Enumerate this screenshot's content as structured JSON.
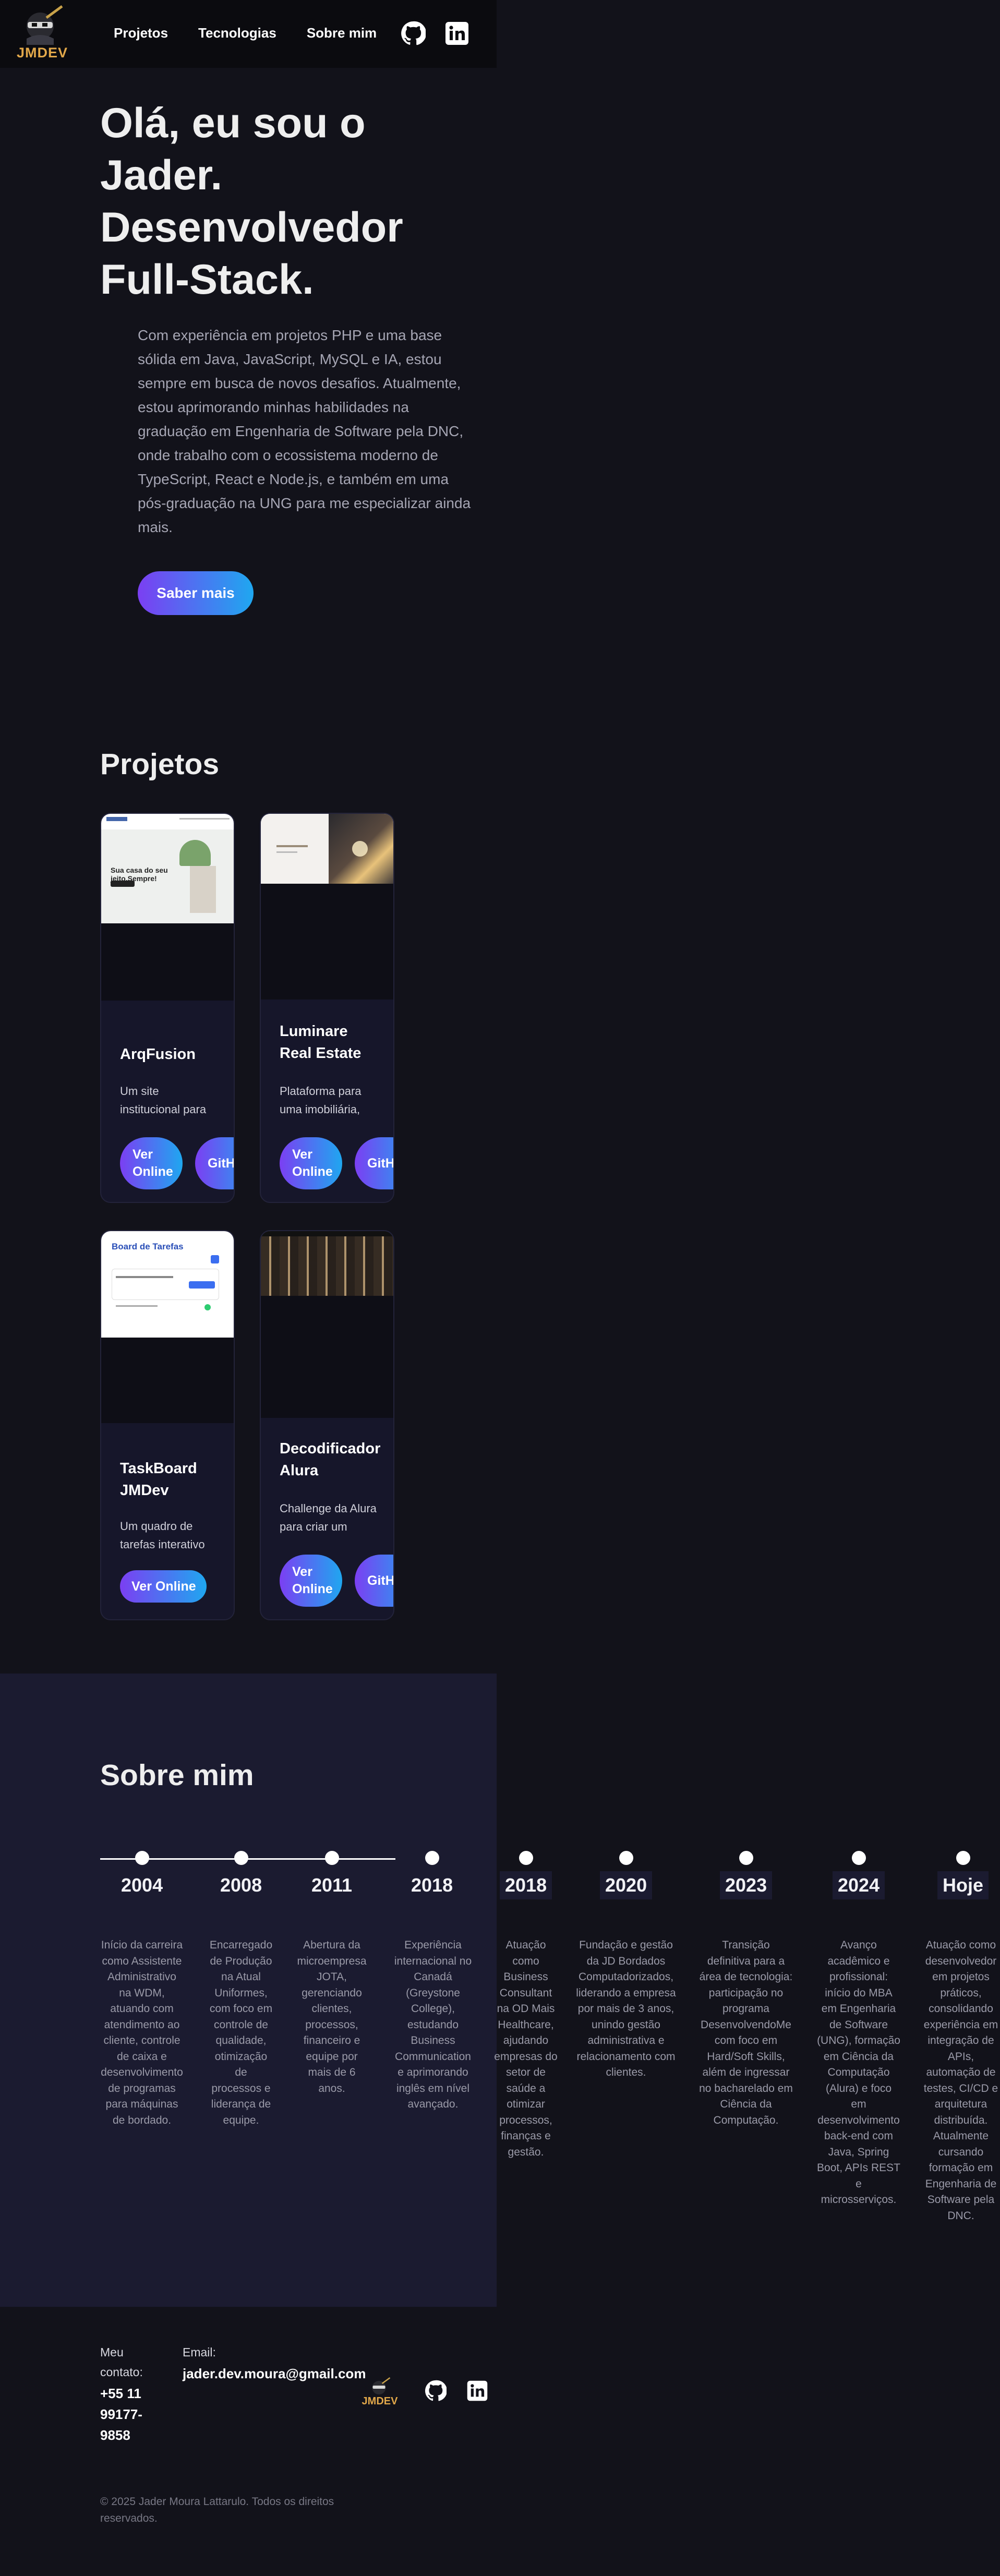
{
  "header": {
    "logo_text": "JMDEV",
    "nav": [
      "Projetos",
      "Tecnologias",
      "Sobre mim"
    ],
    "social": [
      "github-icon",
      "linkedin-icon"
    ]
  },
  "hero": {
    "title": "Olá, eu sou o Jader. Desenvolvedor Full-Stack.",
    "text": "Com experiência em projetos PHP e uma base sólida em Java, JavaScript, MySQL e IA, estou sempre em busca de novos desafios. Atualmente, estou aprimorando minhas habilidades na graduação em Engenharia de Software pela DNC, onde trabalho com o ecossistema moderno de TypeScript, React e Node.js, e também em uma pós-graduação na UNG para me especializar ainda mais.",
    "button": "Saber mais"
  },
  "projects": {
    "title": "Projetos",
    "items": [
      {
        "title": "ArqFusion",
        "desc": "Um site institucional para um escritório de",
        "buttons": [
          "Ver Online",
          "GitHub"
        ]
      },
      {
        "title": "Luminare Real Estate",
        "desc": "Plataforma para uma imobiliária, com listagem e",
        "buttons": [
          "Ver Online",
          "GitHub"
        ]
      },
      {
        "title": "TaskBoard JMDev",
        "desc": "Um quadro de tarefas interativo para organização",
        "buttons": [
          "Ver Online"
        ]
      },
      {
        "title": "Decodificador Alura",
        "desc": "Challenge da Alura para criar um decodificador de",
        "buttons": [
          "Ver Online",
          "GitHub"
        ]
      }
    ],
    "thumbs": {
      "arq_headline": "Sua casa do seu jeito.Sempre!",
      "task_title": "Board de Tarefas"
    }
  },
  "about": {
    "title": "Sobre mim",
    "timeline": [
      {
        "year": "2004",
        "desc": "Início da carreira como Assistente Administrativo na WDM, atuando com atendimento ao cliente, controle de caixa e desenvolvimento de programas para máquinas de bordado."
      },
      {
        "year": "2008",
        "desc": "Encarregado de Produção na Atual Uniformes, com foco em controle de qualidade, otimização de processos e liderança de equipe."
      },
      {
        "year": "2011",
        "desc": "Abertura da microempresa JOTA, gerenciando clientes, processos, financeiro e equipe por mais de 6 anos."
      },
      {
        "year": "2018",
        "desc": "Experiência internacional no Canadá (Greystone College), estudando Business Communication e aprimorando inglês em nível avançado."
      },
      {
        "year": "2018",
        "desc": "Atuação como Business Consultant na OD Mais Healthcare, ajudando empresas do setor de saúde a otimizar processos, finanças e gestão."
      },
      {
        "year": "2020",
        "desc": "Fundação e gestão da JD Bordados Computadorizados, liderando a empresa por mais de 3 anos, unindo gestão administrativa e relacionamento com clientes."
      },
      {
        "year": "2023",
        "desc": "Transição definitiva para a área de tecnologia: participação no programa DesenvolvendoMe com foco em Hard/Soft Skills, além de ingressar no bacharelado em Ciência da Computação."
      },
      {
        "year": "2024",
        "desc": "Avanço acadêmico e profissional: início do MBA em Engenharia de Software (UNG), formação em Ciência da Computação (Alura) e foco em desenvolvimento back-end com Java, Spring Boot, APIs REST e microsserviços."
      },
      {
        "year": "Hoje",
        "desc": "Atuação como desenvolvedor em projetos práticos, consolidando experiência em integração de APIs, automação de testes, CI/CD e arquitetura distribuída. Atualmente cursando formação em Engenharia de Software pela DNC."
      }
    ]
  },
  "footer": {
    "contact_label": "Meu contato:",
    "phone": "+55 11 99177-9858",
    "email_label": "Email:",
    "email": "jader.dev.moura@gmail.com",
    "logo_text": "JMDEV",
    "copyright": "© 2025 Jader Moura Lattarulo. Todos os direitos reservados."
  },
  "colors": {
    "background": "#12121a",
    "about_background": "#1b1b30",
    "accent_start": "#7b3ff2",
    "accent_end": "#1fa7f0",
    "logo": "#e2a84a"
  }
}
